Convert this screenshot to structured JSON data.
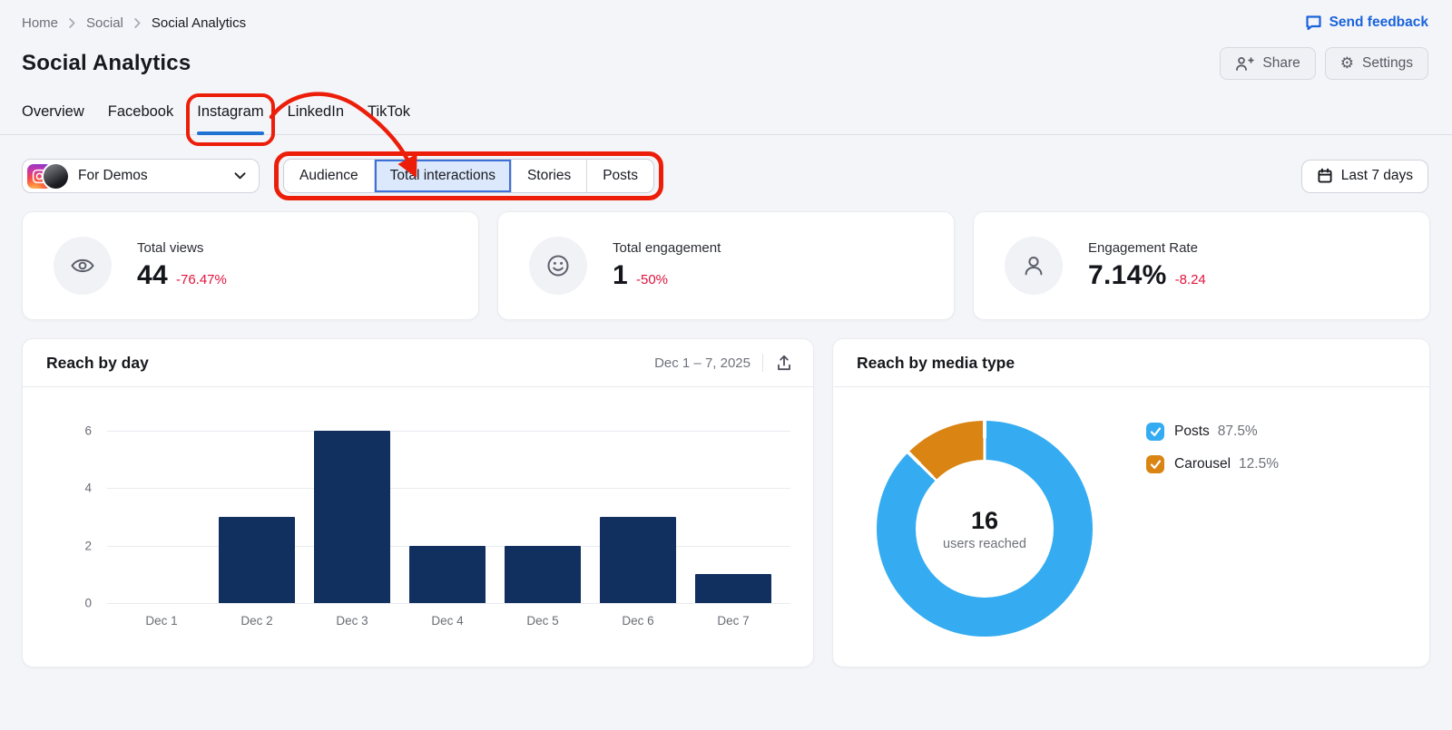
{
  "breadcrumb": {
    "items": [
      "Home",
      "Social",
      "Social Analytics"
    ]
  },
  "feedback": {
    "label": "Send feedback"
  },
  "page": {
    "title": "Social Analytics"
  },
  "actions": {
    "share": "Share",
    "settings": "Settings"
  },
  "tabs": {
    "items": [
      {
        "label": "Overview",
        "active": false
      },
      {
        "label": "Facebook",
        "active": false
      },
      {
        "label": "Instagram",
        "active": true
      },
      {
        "label": "LinkedIn",
        "active": false
      },
      {
        "label": "TikTok",
        "active": false
      }
    ]
  },
  "profile": {
    "name": "For Demos",
    "network": "instagram"
  },
  "segments": {
    "items": [
      {
        "label": "Audience",
        "selected": false
      },
      {
        "label": "Total interactions",
        "selected": true
      },
      {
        "label": "Stories",
        "selected": false
      },
      {
        "label": "Posts",
        "selected": false
      }
    ]
  },
  "date_filter": {
    "label": "Last 7 days"
  },
  "kpis": [
    {
      "icon": "eye-icon",
      "label": "Total views",
      "value": "44",
      "delta": "-76.47%"
    },
    {
      "icon": "smiley-icon",
      "label": "Total engagement",
      "value": "1",
      "delta": "-50%"
    },
    {
      "icon": "person-icon",
      "label": "Engagement Rate",
      "value": "7.14%",
      "delta": "-8.24"
    }
  ],
  "reach_by_day": {
    "title": "Reach by day",
    "date_range": "Dec 1 – 7, 2025"
  },
  "reach_by_media": {
    "title": "Reach by media type",
    "legend": [
      {
        "name": "Posts",
        "pct": "87.5%",
        "color": "#35acf1"
      },
      {
        "name": "Carousel",
        "pct": "12.5%",
        "color": "#d98413"
      }
    ]
  },
  "chart_data": [
    {
      "type": "bar",
      "title": "Reach by day",
      "categories": [
        "Dec 1",
        "Dec 2",
        "Dec 3",
        "Dec 4",
        "Dec 5",
        "Dec 6",
        "Dec 7"
      ],
      "values": [
        0,
        3,
        6,
        2,
        2,
        3,
        1
      ],
      "xlabel": "",
      "ylabel": "",
      "ylim": [
        0,
        6
      ],
      "yticks": [
        0,
        2,
        4,
        6
      ],
      "grid": true,
      "bar_color": "#12305f"
    },
    {
      "type": "pie",
      "title": "Reach by media type",
      "labels": [
        "Posts",
        "Carousel"
      ],
      "values": [
        87.5,
        12.5
      ],
      "colors": [
        "#35acf1",
        "#d98413"
      ],
      "center_value": "16",
      "center_label": "users reached",
      "legend_position": "right"
    }
  ],
  "colors": {
    "accent_blue": "#1a63dc",
    "tab_underline": "#2173d3",
    "negative_red": "#e0143c",
    "bar_navy": "#12305f",
    "donut_blue": "#35acf1",
    "donut_orange": "#d98413",
    "annotation_red": "#ec1e0a"
  }
}
